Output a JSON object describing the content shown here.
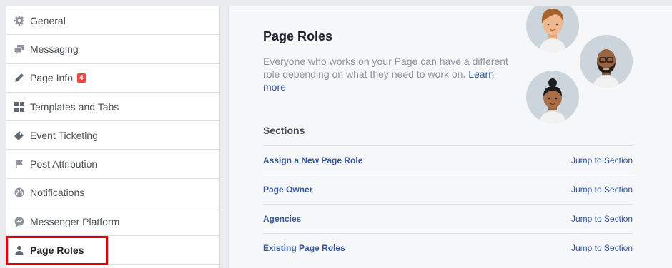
{
  "sidebar": {
    "items": [
      {
        "label": "General",
        "icon": "gear-icon"
      },
      {
        "label": "Messaging",
        "icon": "chat-bubbles-icon"
      },
      {
        "label": "Page Info",
        "icon": "pencil-icon",
        "badge": "4"
      },
      {
        "label": "Templates and Tabs",
        "icon": "grid-icon"
      },
      {
        "label": "Event Ticketing",
        "icon": "ticket-icon"
      },
      {
        "label": "Post Attribution",
        "icon": "flag-icon"
      },
      {
        "label": "Notifications",
        "icon": "globe-icon"
      },
      {
        "label": "Messenger Platform",
        "icon": "messenger-icon"
      },
      {
        "label": "Page Roles",
        "icon": "person-icon",
        "active": true
      }
    ]
  },
  "main": {
    "title": "Page Roles",
    "description": "Everyone who works on your Page can have a different role depending on what they need to work on.",
    "learn_more": "Learn more",
    "sections_header": "Sections",
    "sections": [
      {
        "name": "Assign a New Page Role",
        "jump": "Jump to Section"
      },
      {
        "name": "Page Owner",
        "jump": "Jump to Section"
      },
      {
        "name": "Agencies",
        "jump": "Jump to Section"
      },
      {
        "name": "Existing Page Roles",
        "jump": "Jump to Section"
      }
    ]
  },
  "colors": {
    "link": "#365899",
    "badge": "#fa3e3e",
    "highlight": "#e8000d",
    "avatar_bg": "#ccd5dc"
  }
}
